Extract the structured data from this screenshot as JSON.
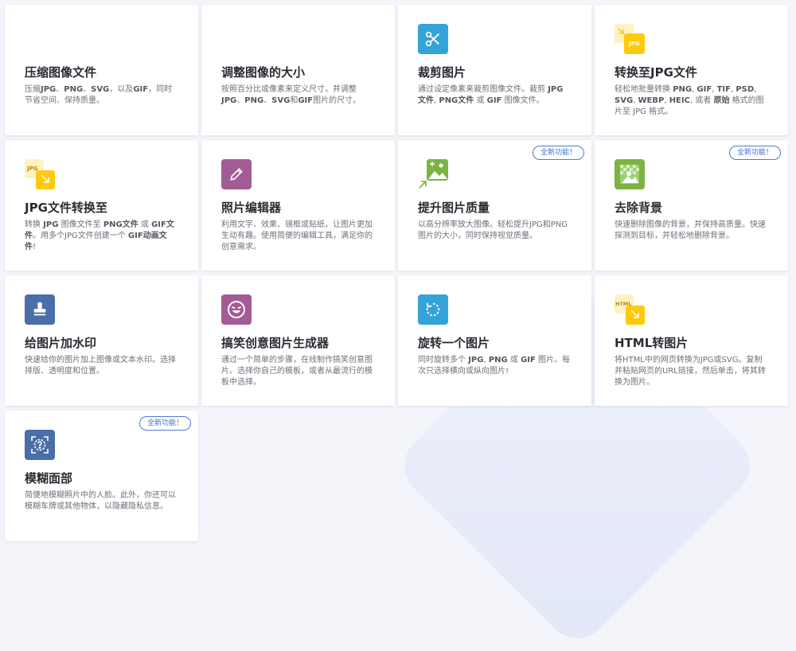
{
  "colors": {
    "green": "#7cb342",
    "teal": "#33a3d8",
    "yellow": "#ffc90e",
    "purple": "#a35b95",
    "blue": "#4a6ea8",
    "badge": "#4d7bd3"
  },
  "tools": [
    {
      "id": "compress",
      "icon": "compress-arrows-icon",
      "title": "压缩图像文件",
      "desc_html": "压缩<b>JPG</b>、<b>PNG</b>、<b>SVG</b>，以及<b>GIF</b>，同时节省空间、保持质量。"
    },
    {
      "id": "resize",
      "icon": "resize-image-icon",
      "title": "调整图像的大小",
      "desc_html": "按照百分比或像素来定义尺寸，并调整<b>JPG</b>、<b>PNG</b>、<b>SVG</b>和<b>GIF</b>图片的尺寸。"
    },
    {
      "id": "crop",
      "icon": "scissors-icon",
      "title": "裁剪图片",
      "desc_html": "通过设定像素来裁剪图像文件。裁剪 <b>JPG文件</b>, <b>PNG文件</b> 或 <b>GIF</b> 图像文件。"
    },
    {
      "id": "to-jpg",
      "icon": "convert-to-jpg-icon",
      "title": "转换至JPG文件",
      "desc_html": "轻松地批量转换 <b>PNG</b>, <b>GIF</b>, <b>TIF</b>, <b>PSD</b>, <b>SVG</b>, <b>WEBP</b>, <b>HEIC</b>, 或者 <b>原始</b> 格式的图片至 JPG 格式。"
    },
    {
      "id": "from-jpg",
      "icon": "convert-from-jpg-icon",
      "title": "JPG文件转换至",
      "desc_html": "转换 <b>JPG</b> 图像文件至 <b>PNG文件</b> 或 <b>GIF文件</b>。用多个JPG文件创建一个 <b>GIF动画文件</b>!"
    },
    {
      "id": "editor",
      "icon": "pencil-icon",
      "title": "照片编辑器",
      "desc_html": "利用文字、效果、镜框或贴纸，让图片更加生动有趣。使用简便的编辑工具，满足你的创意需求。"
    },
    {
      "id": "upscale",
      "icon": "upscale-image-icon",
      "title": "提升图片质量",
      "desc_html": "以高分辨率放大图像。轻松提升JPG和PNG图片的大小，同时保持视觉质量。",
      "badge": "全新功能！"
    },
    {
      "id": "remove-bg",
      "icon": "remove-background-icon",
      "title": "去除背景",
      "desc_html": "快速删除图像的背景，并保持高质量。快速探测到目标，并轻松地删除背景。",
      "badge": "全新功能！"
    },
    {
      "id": "watermark",
      "icon": "stamp-icon",
      "title": "给图片加水印",
      "desc_html": "快速给你的图片加上图像或文本水印。选择排版、透明度和位置。"
    },
    {
      "id": "meme",
      "icon": "laughing-face-icon",
      "title": "搞笑创意图片生成器",
      "desc_html": "通过一个简单的步骤，在线制作搞笑创意图片。选择你自己的模板，或者从最流行的模板中选择。"
    },
    {
      "id": "rotate",
      "icon": "rotate-icon",
      "title": "旋转一个图片",
      "desc_html": "同时旋转多个 <b>JPG</b>, <b>PNG</b> 或 <b>GIF</b> 图片。每次只选择横向或纵向图片!"
    },
    {
      "id": "html-to-image",
      "icon": "html-to-image-icon",
      "title": "HTML转图片",
      "desc_html": "将HTML中的网页转换为JPG或SVG。复制并粘贴网页的URL链接，然后单击，将其转换为图片。"
    },
    {
      "id": "blur-face",
      "icon": "blur-face-icon",
      "title": "模糊面部",
      "desc_html": "简便地模糊照片中的人脸。此外，你还可以模糊车牌或其他物体，以隐藏隐私信息。",
      "badge": "全新功能！"
    }
  ]
}
